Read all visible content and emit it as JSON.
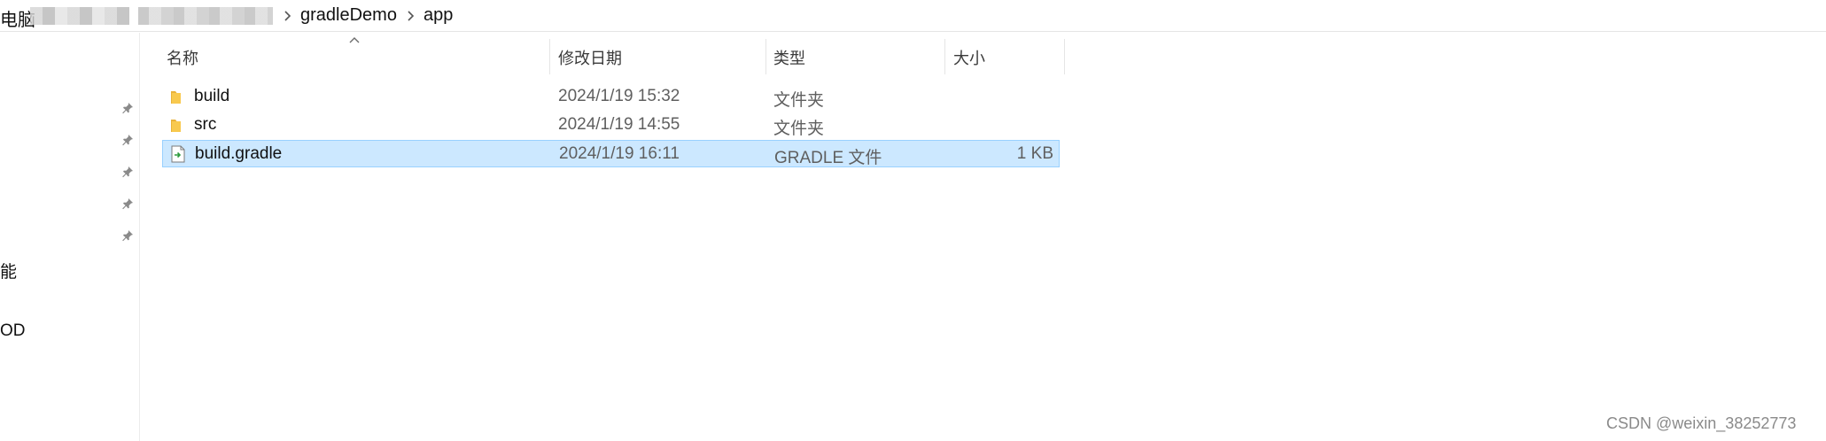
{
  "breadcrumb": {
    "root_fragment": "电脑",
    "items": [
      "gradleDemo",
      "app"
    ]
  },
  "nav": {
    "fragments": [
      "能",
      "OD"
    ]
  },
  "columns": {
    "name": "名称",
    "date": "修改日期",
    "type": "类型",
    "size": "大小"
  },
  "files": [
    {
      "name": "build",
      "date": "2024/1/19 15:32",
      "type": "文件夹",
      "size": "",
      "icon": "folder-icon"
    },
    {
      "name": "src",
      "date": "2024/1/19 14:55",
      "type": "文件夹",
      "size": "",
      "icon": "folder-icon"
    },
    {
      "name": "build.gradle",
      "date": "2024/1/19 16:11",
      "type": "GRADLE 文件",
      "size": "1 KB",
      "icon": "gradle-file-icon",
      "selected": true
    }
  ],
  "watermark": "CSDN @weixin_38252773",
  "colors": {
    "selection_bg": "#cce8ff",
    "selection_border": "#99d1ff",
    "folder": "#f8c94e"
  }
}
